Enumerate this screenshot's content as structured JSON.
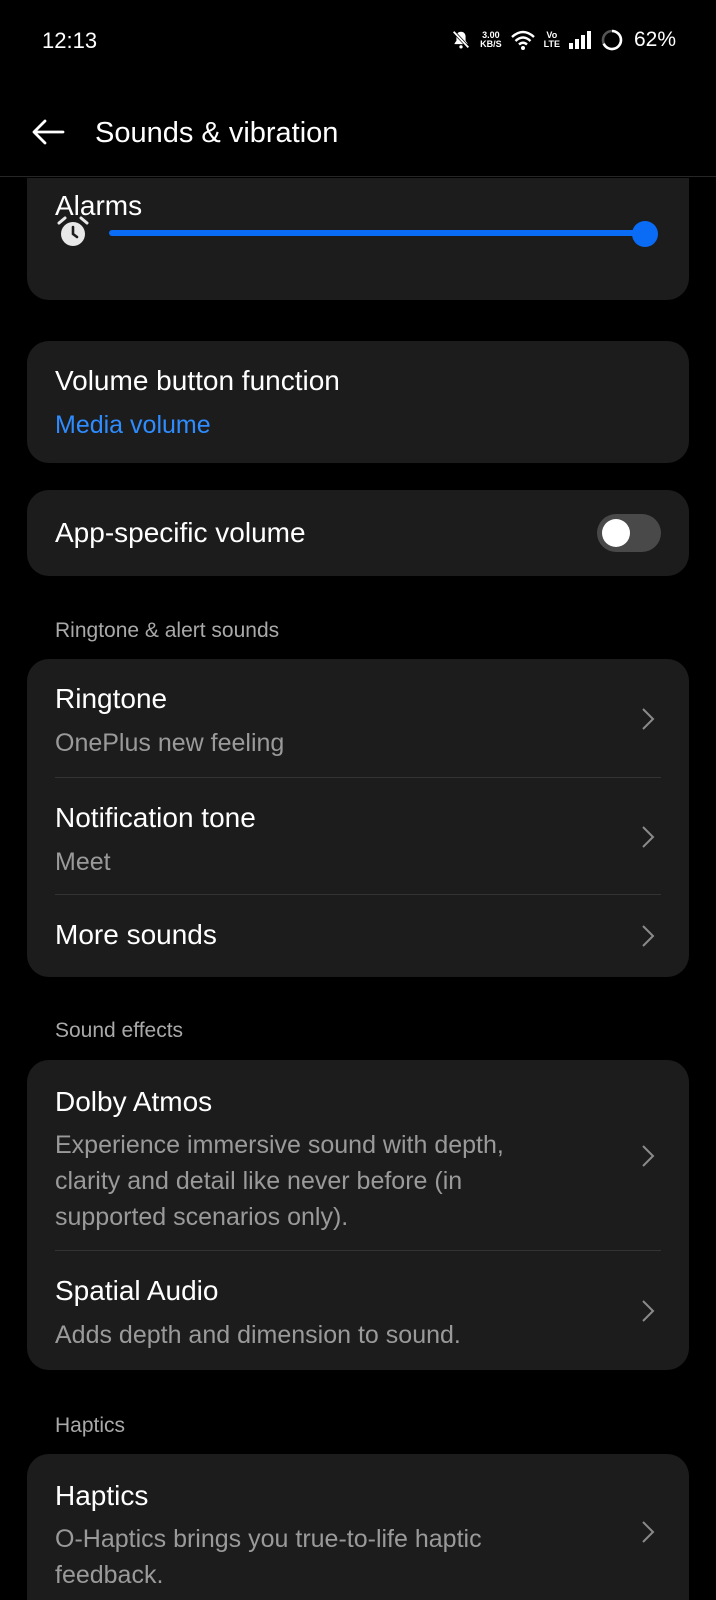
{
  "status_bar": {
    "time": "12:13",
    "net_speed_value": "3.00",
    "net_speed_unit": "KB/S",
    "volte_top": "Vo",
    "volte_bottom": "LTE",
    "battery": "62%",
    "icons": [
      "mute-bell-icon",
      "wifi-icon",
      "volte-icon",
      "signal-icon",
      "battery-ring-icon"
    ]
  },
  "app_bar": {
    "title": "Sounds & vibration",
    "back_icon": "arrow-left-icon"
  },
  "alarms": {
    "label": "Alarms",
    "icon": "alarm-clock-icon",
    "level": 1.0,
    "accent_color": "#0a6cf5"
  },
  "volume_button": {
    "title": "Volume button function",
    "value": "Media volume",
    "value_color": "#2e8cff"
  },
  "app_specific_volume": {
    "title": "App-specific volume",
    "enabled": false
  },
  "sections": {
    "ringtone_alert": "Ringtone & alert sounds",
    "sound_effects": "Sound effects",
    "haptics": "Haptics"
  },
  "ringtone_items": [
    {
      "title": "Ringtone",
      "subtitle": "OnePlus new feeling"
    },
    {
      "title": "Notification tone",
      "subtitle": "Meet"
    },
    {
      "title": "More sounds"
    }
  ],
  "sound_effect_items": [
    {
      "title": "Dolby Atmos",
      "subtitle_lines": [
        "Experience immersive sound with depth,",
        "clarity and detail like never before (in",
        "supported scenarios only)."
      ]
    },
    {
      "title": "Spatial Audio",
      "subtitle": "Adds depth and dimension to sound."
    }
  ],
  "haptic_items": [
    {
      "title": "Haptics",
      "subtitle": "O-Haptics brings you true-to-life haptic",
      "subtitle_cut": "feedback."
    }
  ]
}
